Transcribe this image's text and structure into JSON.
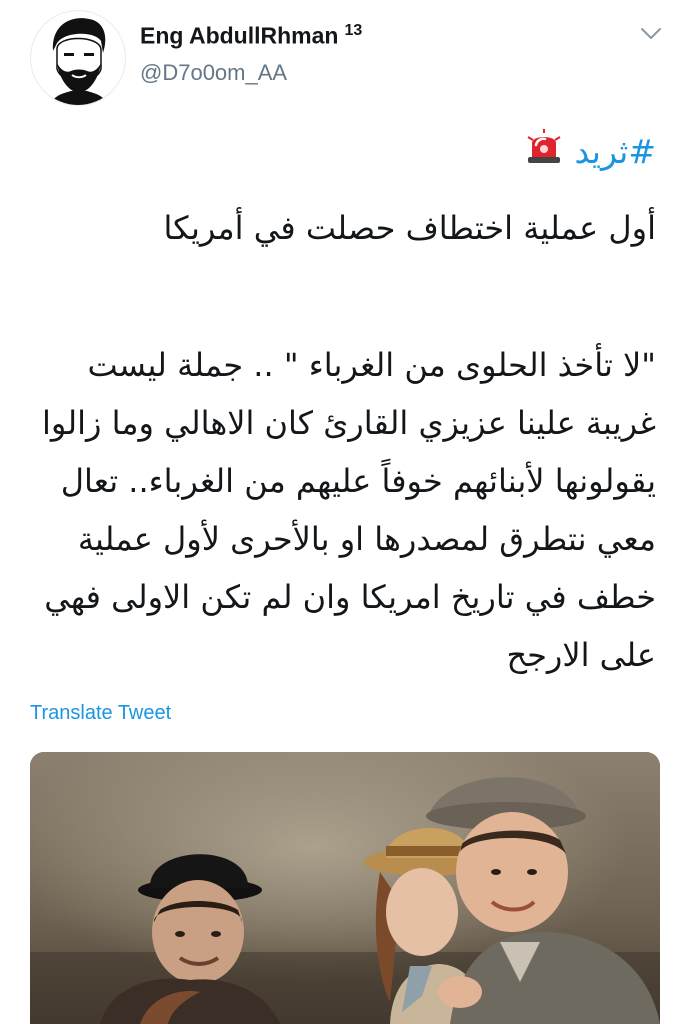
{
  "author": {
    "name": "Eng AbdullRhman",
    "badge": "13",
    "handle": "@D7o0om_AA"
  },
  "tweet": {
    "hashtag": "#ثريد",
    "title": "أول عملية اختطاف حصلت في أمريكا",
    "paragraph": "\"لا تأخذ الحلوى من الغرباء \" .. جملة ليست غريبة علينا عزيزي القارئ كان الاهالي وما زالوا يقولونها لأبنائهم خوفاً عليهم من الغرباء.. تعال معي نتطرق لمصدرها او بالأحرى لأول عملية خطف في تاريخ امريكا وان لم تكن الاولى فهي على الارجح"
  },
  "actions": {
    "translate_label": "Translate Tweet"
  },
  "icons": {
    "siren": "police-siren-emoji",
    "caret": "chevron-down-icon",
    "avatar": "bearded-man-avatar"
  },
  "colors": {
    "link": "#1b95e0",
    "text": "#14171a",
    "secondary": "#657786"
  }
}
